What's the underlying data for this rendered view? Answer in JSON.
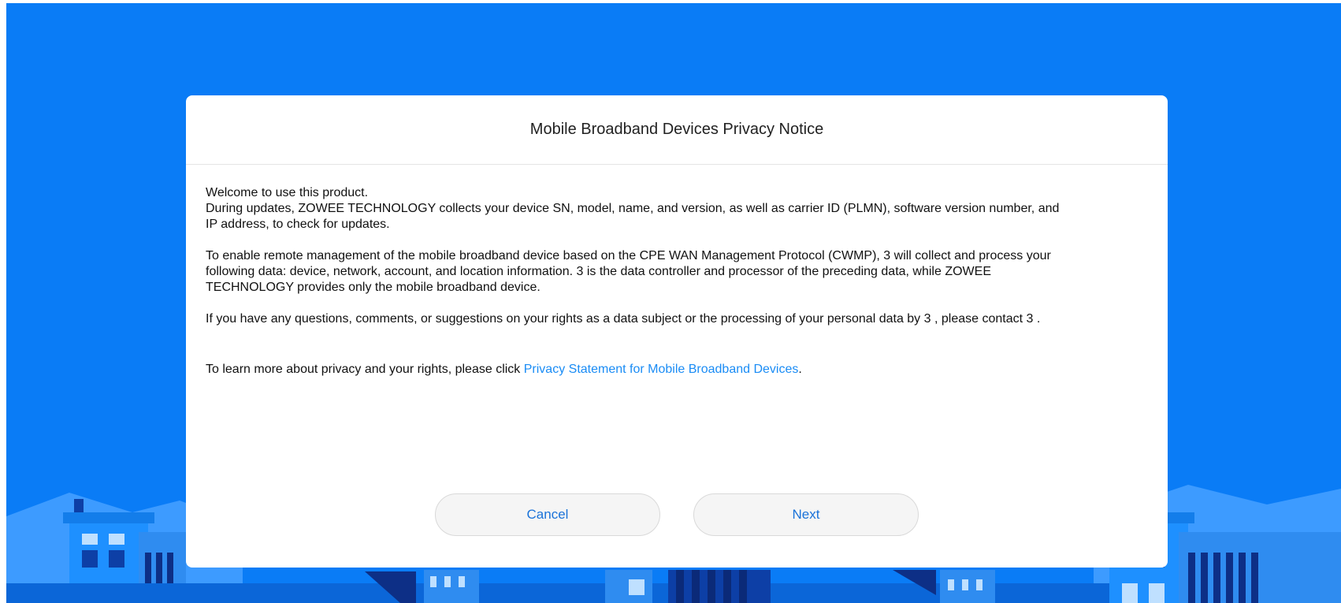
{
  "dialog": {
    "title": "Mobile Broadband Devices Privacy Notice",
    "para1_line1": "Welcome to use this product.",
    "para1_line2": "During updates, ZOWEE TECHNOLOGY collects your device SN, model, name, and version, as well as carrier ID (PLMN), software version number, and",
    "para1_line3": "IP address, to check for updates.",
    "para2_line1": "To enable remote management of the mobile broadband device based on the CPE WAN Management Protocol (CWMP), 3 will collect and process your",
    "para2_line2": "following data: device, network, account, and location information. 3 is the data controller and processor of the preceding data, while ZOWEE",
    "para2_line3": "TECHNOLOGY provides only the mobile broadband device.",
    "para3": "If you have any questions, comments, or suggestions on your rights as a data subject or the processing of your personal data by 3 , please contact 3 .",
    "para4_prefix": "To learn more about privacy and your rights, please click ",
    "privacy_link": "Privacy Statement for Mobile Broadband Devices",
    "para4_suffix": ".",
    "cancel_label": "Cancel",
    "next_label": "Next"
  },
  "colors": {
    "background": "#0a7cf6",
    "dialog": "#ffffff",
    "link": "#1a8cf5",
    "button_text": "#1a73d9",
    "button_bg": "#f5f5f5"
  }
}
